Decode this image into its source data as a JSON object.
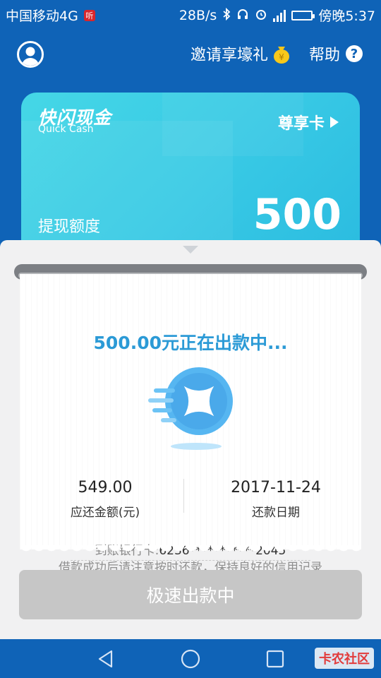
{
  "status_bar": {
    "carrier": "中国移动4G",
    "carrier_badge": "听",
    "speed": "28B/s",
    "time": "傍晚5:37",
    "network_label": "4G"
  },
  "header": {
    "invite_label": "邀请享壕礼",
    "help_label": "帮助",
    "help_icon_glyph": "?"
  },
  "card": {
    "brand_cn": "快闪现金",
    "brand_en": "Quick Cash",
    "vip_label": "尊享卡",
    "limit_label": "提现额度",
    "limit_value": "500"
  },
  "receipt": {
    "status": "500.00元正在出款中...",
    "repay_amount": "549.00",
    "repay_amount_label": "应还金额(元)",
    "repay_date": "2017-11-24",
    "repay_date_label": "还款日期",
    "bank_label": "到账银行卡:",
    "bank_number": "6236***********2045",
    "tip": "借款成功后请注意按时还款，保持良好的信用记录"
  },
  "action": {
    "button_label": "极速出款中"
  },
  "watermark": "卡农社区",
  "colors": {
    "primary_blue": "#0f63b7",
    "card_cyan": "#38c9e5",
    "status_blue": "#2b9ad6",
    "disabled_button": "#c6c6c6"
  }
}
